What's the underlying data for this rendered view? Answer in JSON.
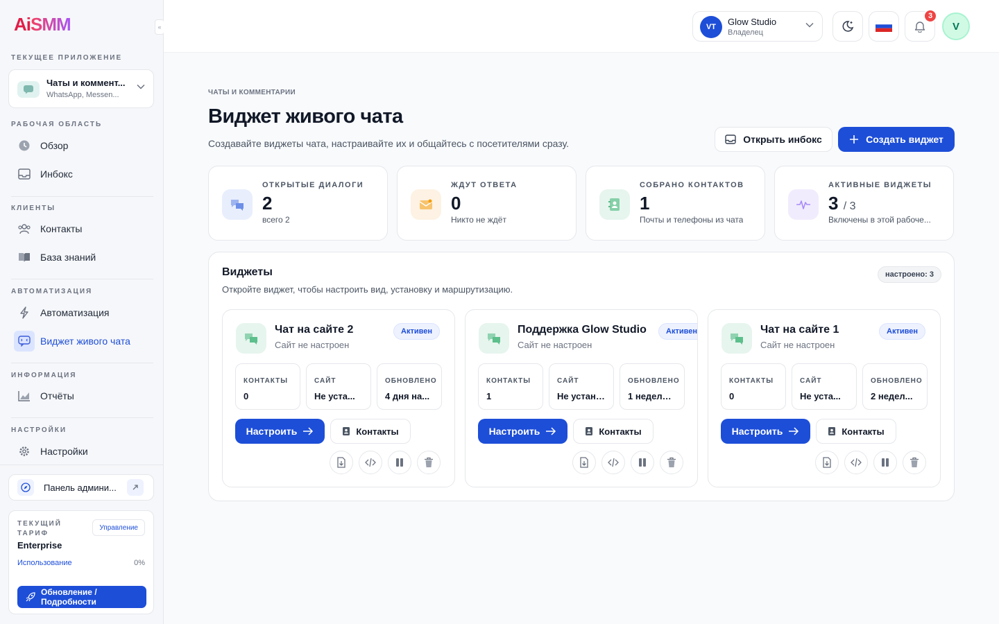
{
  "brand": {
    "logo_a": "Ai",
    "logo_b": "SMM",
    "collapse": "«"
  },
  "sidebar": {
    "current_app_label": "ТЕКУЩЕЕ ПРИЛОЖЕНИЕ",
    "current_app": {
      "title": "Чаты и коммент...",
      "subtitle": "WhatsApp, Messen..."
    },
    "sections": [
      {
        "label": "РАБОЧАЯ ОБЛАСТЬ",
        "items": [
          {
            "label": "Обзор",
            "icon": "clock-icon"
          },
          {
            "label": "Инбокс",
            "icon": "inbox-icon"
          }
        ]
      },
      {
        "label": "КЛИЕНТЫ",
        "items": [
          {
            "label": "Контакты",
            "icon": "users-icon"
          },
          {
            "label": "База знаний",
            "icon": "book-icon"
          }
        ]
      },
      {
        "label": "АВТОМАТИЗАЦИЯ",
        "items": [
          {
            "label": "Автоматизация",
            "icon": "bolt-icon"
          },
          {
            "label": "Виджет живого чата",
            "icon": "chat-widget-icon",
            "active": true
          }
        ]
      },
      {
        "label": "ИНФОРМАЦИЯ",
        "items": [
          {
            "label": "Отчёты",
            "icon": "chart-icon"
          }
        ]
      },
      {
        "label": "НАСТРОЙКИ",
        "items": [
          {
            "label": "Настройки",
            "icon": "gear-icon"
          }
        ]
      }
    ],
    "admin_panel": "Панель админи...",
    "plan": {
      "label": "ТЕКУЩИЙ ТАРИФ",
      "value": "Enterprise",
      "manage": "Управление",
      "usage_label": "Использование",
      "usage_value": "0%",
      "upgrade": "Обновление / Подробности"
    }
  },
  "topbar": {
    "workspace": {
      "initials": "VT",
      "name": "Glow Studio",
      "role": "Владелец"
    },
    "notifications_count": "3",
    "user_initial": "V"
  },
  "page": {
    "breadcrumb": "ЧАТЫ И КОММЕНТАРИИ",
    "title": "Виджет живого чата",
    "subtitle": "Создавайте виджеты чата, настраивайте их и общайтесь с посетителями сразу.",
    "open_inbox": "Открыть инбокс",
    "create_widget": "Создать виджет"
  },
  "stats": [
    {
      "label": "ОТКРЫТЫЕ ДИАЛОГИ",
      "value": "2",
      "extra": "",
      "desc": "всего 2",
      "color": "#e8eefc"
    },
    {
      "label": "ЖДУТ ОТВЕТА",
      "value": "0",
      "extra": "",
      "desc": "Никто не ждёт",
      "color": "#fdf2e3"
    },
    {
      "label": "СОБРАНО КОНТАКТОВ",
      "value": "1",
      "extra": "",
      "desc": "Почты и телефоны из чата",
      "color": "#e6f5ee"
    },
    {
      "label": "АКТИВНЫЕ ВИДЖЕТЫ",
      "value": "3",
      "extra": "/ 3",
      "desc": "Включены в этой рабоче...",
      "color": "#f1ecfd"
    }
  ],
  "widgets": {
    "title": "Виджеты",
    "subtitle": "Откройте виджет, чтобы настроить вид, установку и маршрутизацию.",
    "configured": "настроено: 3",
    "configure_label": "Настроить",
    "contacts_label": "Контакты",
    "col_contacts": "КОНТАКТЫ",
    "col_site": "САЙТ",
    "col_updated": "ОБНОВЛЕНО",
    "items": [
      {
        "name": "Чат на сайте 2",
        "site": "Сайт не настроен",
        "status": "Активен",
        "contacts": "0",
        "site_value": "Не уста...",
        "updated": "4 дня на..."
      },
      {
        "name": "Поддержка Glow Studio",
        "site": "Сайт не настроен",
        "status": "Активен",
        "contacts": "1",
        "site_value": "Не устано...",
        "updated": "1 неделю ..."
      },
      {
        "name": "Чат на сайте 1",
        "site": "Сайт не настроен",
        "status": "Активен",
        "contacts": "0",
        "site_value": "Не уста...",
        "updated": "2 недел..."
      }
    ]
  }
}
